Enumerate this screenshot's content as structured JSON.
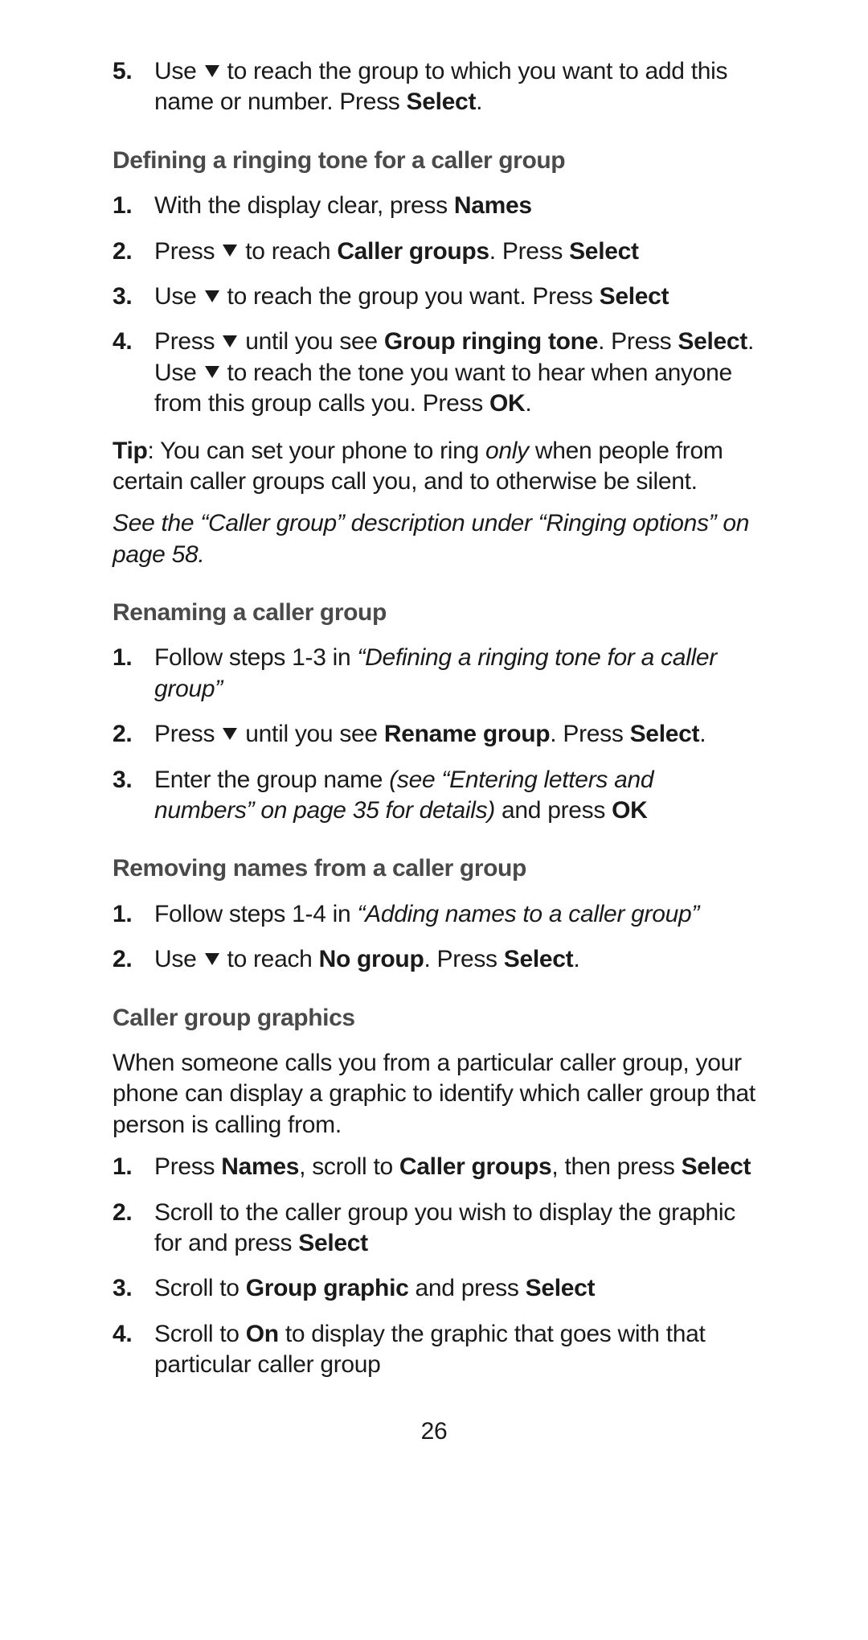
{
  "intro_step": {
    "num": "5.",
    "pre": "Use ",
    "post": " to reach the group to which you want to add this name or number. Press ",
    "btn": "Select",
    "tail": "."
  },
  "s1": {
    "heading": "Defining a ringing tone for a caller group",
    "steps": [
      {
        "num": "1.",
        "pre": "With the display clear, press ",
        "btn": "Names"
      },
      {
        "num": "2.",
        "pre": "Press ",
        "mid": " to reach ",
        "b1": "Caller groups",
        "post": ". Press ",
        "b2": "Select",
        "has_tri": true
      },
      {
        "num": "3.",
        "pre": "Use ",
        "post": " to reach the group you want. Press ",
        "btn": "Select",
        "has_tri": true
      },
      {
        "num": "4.",
        "p1a": "Press ",
        "p1b": " until you see ",
        "p1btn": "Group ringing tone",
        "p1c": ". Press ",
        "p2btn": "Select",
        "p2a": ". Use ",
        "p2b": " to reach the tone you want to hear when anyone from this group calls you. Press ",
        "p3btn": "OK",
        "p3a": "."
      }
    ],
    "tip_label": "Tip",
    "tip_a": ": You can set your phone to ring ",
    "tip_em": "only",
    "tip_b": " when people from certain caller groups call you, and to otherwise be silent.",
    "ref": "See the “Caller group” description under “Ringing options” on page 58."
  },
  "s2": {
    "heading": "Renaming a caller group",
    "steps": [
      {
        "num": "1.",
        "pre": "Follow steps 1-3 in ",
        "em": "“Defining a ringing tone for a caller group”"
      },
      {
        "num": "2.",
        "pre": "Press ",
        "post": " until you see ",
        "b1": "Rename group",
        "mid": ". Press ",
        "b2": "Select",
        "tail": ".",
        "has_tri": true
      },
      {
        "num": "3.",
        "pre": "Enter the group name ",
        "em": "(see “Entering letters and numbers” on page 35 for details)",
        "post": " and press ",
        "btn": "OK"
      }
    ]
  },
  "s3": {
    "heading": "Removing names from a caller group",
    "steps": [
      {
        "num": "1.",
        "pre": "Follow steps 1-4 in ",
        "em": "“Adding names to a caller group”"
      },
      {
        "num": "2.",
        "pre": "Use ",
        "post": " to reach ",
        "b1": "No group",
        "mid": ". Press ",
        "b2": "Select",
        "tail": ".",
        "has_tri": true
      }
    ]
  },
  "s4": {
    "heading": "Caller group graphics",
    "intro": "When someone calls you from a particular caller group, your phone can display a graphic to identify which caller group that person is calling from.",
    "steps": [
      {
        "num": "1.",
        "pre": "Press ",
        "b1": "Names",
        "mid": ", scroll to ",
        "b2": "Caller groups",
        "post": ", then press ",
        "b3": "Select"
      },
      {
        "num": "2.",
        "pre": "Scroll to the caller group you wish to display the graphic for and press ",
        "btn": "Select"
      },
      {
        "num": "3.",
        "pre": "Scroll to ",
        "b1": "Group graphic",
        "post": " and press ",
        "b2": "Select"
      },
      {
        "num": "4.",
        "pre": "Scroll to ",
        "b1": "On",
        "post": " to display the graphic that goes with that particular caller group"
      }
    ]
  },
  "page_number": "26"
}
